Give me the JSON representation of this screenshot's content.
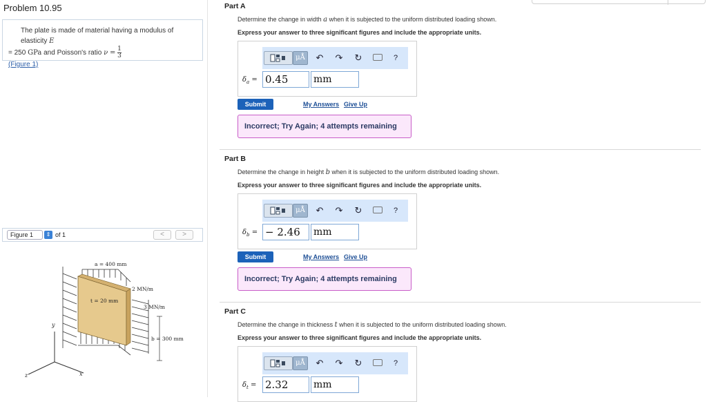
{
  "problem": {
    "title": "Problem 10.95",
    "statement_line1_prefix": "The plate is made of material having a modulus of elasticity",
    "E_symbol": "E",
    "statement_line2_eq": "= 250",
    "E_unit": "GPa",
    "statement_line2_mid": "and Poisson's ratio",
    "nu_symbol": "ν",
    "nu_eq": "=",
    "nu_num": "1",
    "nu_den": "3",
    "figure_link": "(Figure 1)"
  },
  "figure_nav": {
    "selected": "Figure 1",
    "of_text": "of 1",
    "prev": "<",
    "next": ">"
  },
  "figure": {
    "label_a": "a = 400 mm",
    "label_t": "t = 20 mm",
    "label_2mn": "2 MN/m",
    "label_3mn": "3 MN/m",
    "label_b": "b = 300 mm",
    "axis_x": "x",
    "axis_y": "y",
    "axis_z": "z"
  },
  "toolbar": {
    "mu_label": "μÅ",
    "undo": "↶",
    "redo": "↷",
    "reset": "↻",
    "keyboard": "⌨",
    "help": "?"
  },
  "parts": [
    {
      "title": "Part A",
      "question_prefix": "Determine the change in width",
      "var": "a",
      "question_suffix": "when it is subjected to the uniform distributed loading shown.",
      "instruction": "Express your answer to three significant figures and include the appropriate units.",
      "label_symbol": "δ",
      "label_sub": "a",
      "label_eq": "=",
      "value": "0.45",
      "unit": "mm",
      "submit": "Submit",
      "my_answers": "My Answers",
      "give_up": "Give Up",
      "feedback": "Incorrect; Try Again; 4 attempts remaining"
    },
    {
      "title": "Part B",
      "question_prefix": "Determine the change in height",
      "var": "b",
      "question_suffix": "when it is subjected to the uniform distributed loading shown.",
      "instruction": "Express your answer to three significant figures and include the appropriate units.",
      "label_symbol": "δ",
      "label_sub": "b",
      "label_eq": "=",
      "value": "− 2.46",
      "unit": "mm",
      "submit": "Submit",
      "my_answers": "My Answers",
      "give_up": "Give Up",
      "feedback": "Incorrect; Try Again; 4 attempts remaining"
    },
    {
      "title": "Part C",
      "question_prefix": "Determine the change in thickness",
      "var": "t",
      "question_suffix": "when it is subjected to the uniform distributed loading shown.",
      "instruction": "Express your answer to three significant figures and include the appropriate units.",
      "label_symbol": "δ",
      "label_sub": "t",
      "label_eq": "=",
      "value": "2.32",
      "unit": "mm"
    }
  ],
  "colors": {
    "submit_bg": "#1c62b9",
    "feedback_bg": "#fbe8fb",
    "feedback_border": "#c85cc8",
    "toolbar_bg": "#d7e7fb",
    "plate_fill": "#e6c98d"
  }
}
